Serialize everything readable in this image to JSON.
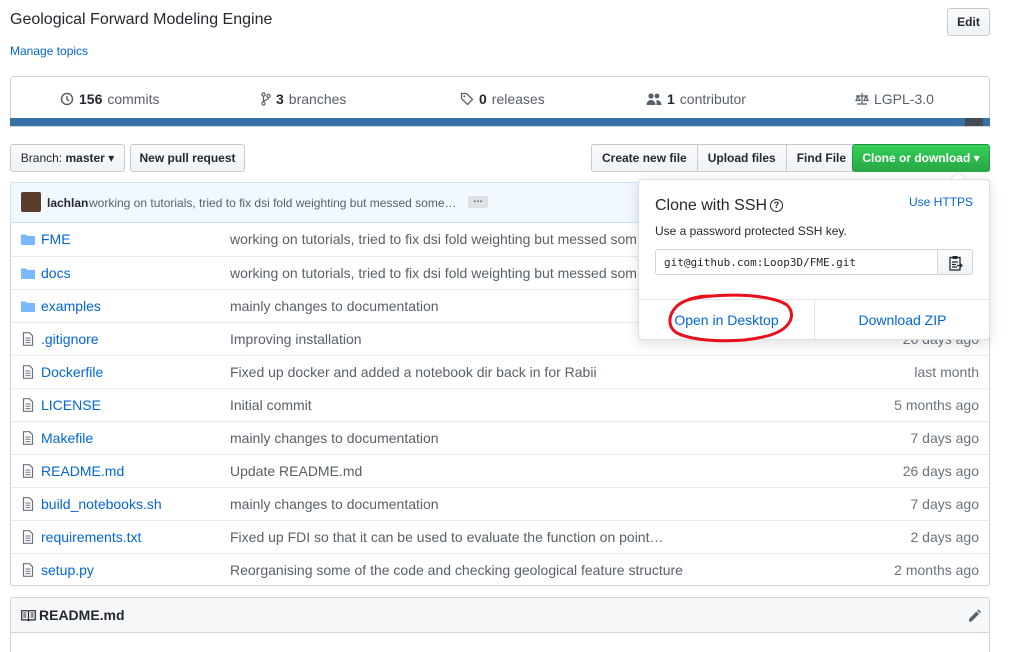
{
  "repo": {
    "description": "Geological Forward Modeling Engine",
    "manage_topics": "Manage topics",
    "edit_label": "Edit"
  },
  "summary": {
    "commits_count": "156",
    "commits_label": "commits",
    "branches_count": "3",
    "branches_label": "branches",
    "releases_count": "0",
    "releases_label": "releases",
    "contributors_count": "1",
    "contributors_label": "contributor",
    "license": "LGPL-3.0"
  },
  "toolbar": {
    "branch_prefix": "Branch:",
    "branch_name": "master",
    "new_pr": "New pull request",
    "create_file": "Create new file",
    "upload_files": "Upload files",
    "find_file": "Find File",
    "clone": "Clone or download"
  },
  "latest_commit": {
    "author": "lachlan",
    "message": "working on tutorials, tried to fix dsi fold weighting but messed some…",
    "more": "…"
  },
  "files": [
    {
      "type": "dir",
      "name": "FME",
      "message": "working on tutorials, tried to fix dsi fold weighting but messed som",
      "age": ""
    },
    {
      "type": "dir",
      "name": "docs",
      "message": "working on tutorials, tried to fix dsi fold weighting but messed som",
      "age": ""
    },
    {
      "type": "dir",
      "name": "examples",
      "message": "mainly changes to documentation",
      "age": ""
    },
    {
      "type": "file",
      "name": ".gitignore",
      "message": "Improving installation",
      "age": "26 days ago"
    },
    {
      "type": "file",
      "name": "Dockerfile",
      "message": "Fixed up docker and added a notebook dir back in for Rabii",
      "age": "last month"
    },
    {
      "type": "file",
      "name": "LICENSE",
      "message": "Initial commit",
      "age": "5 months ago"
    },
    {
      "type": "file",
      "name": "Makefile",
      "message": "mainly changes to documentation",
      "age": "7 days ago"
    },
    {
      "type": "file",
      "name": "README.md",
      "message": "Update README.md",
      "age": "26 days ago"
    },
    {
      "type": "file",
      "name": "build_notebooks.sh",
      "message": "mainly changes to documentation",
      "age": "7 days ago"
    },
    {
      "type": "file",
      "name": "requirements.txt",
      "message": "Fixed up FDI so that it can be used to evaluate the function on point…",
      "age": "2 days ago"
    },
    {
      "type": "file",
      "name": "setup.py",
      "message": "Reorganising some of the code and checking geological feature structure",
      "age": "2 months ago"
    }
  ],
  "readme": {
    "title": "README.md"
  },
  "clone_dropdown": {
    "title": "Clone with SSH",
    "help": "?",
    "switch_link": "Use HTTPS",
    "note": "Use a password protected SSH key.",
    "url": "git@github.com:Loop3D/FME.git",
    "open_desktop": "Open in Desktop",
    "download_zip": "Download ZIP"
  },
  "colors": {
    "link": "#0366d6",
    "primary_green": "#28a745",
    "language_bar": "#3572a5",
    "annotation_red": "#e8101c"
  }
}
